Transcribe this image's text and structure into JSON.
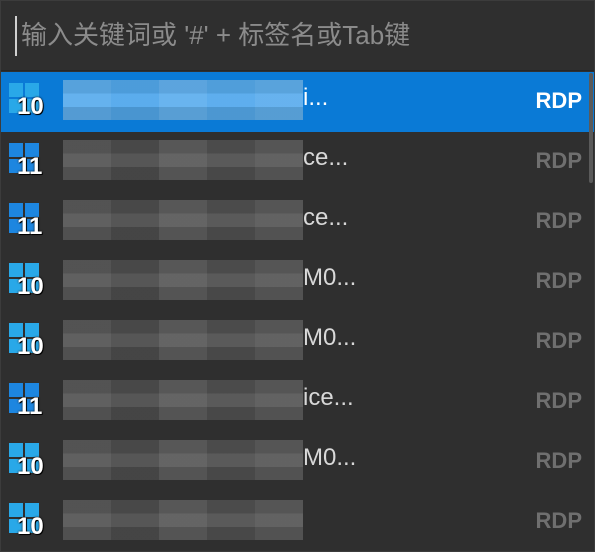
{
  "search": {
    "placeholder": "输入关键词或 '#' + 标签名或Tab键",
    "value": ""
  },
  "items": [
    {
      "os_version": "10",
      "name_suffix": "i...",
      "protocol": "RDP",
      "selected": true
    },
    {
      "os_version": "11",
      "name_suffix": "ce...",
      "protocol": "RDP",
      "selected": false
    },
    {
      "os_version": "11",
      "name_suffix": "ce...",
      "protocol": "RDP",
      "selected": false
    },
    {
      "os_version": "10",
      "name_suffix": "M0...",
      "protocol": "RDP",
      "selected": false
    },
    {
      "os_version": "10",
      "name_suffix": "M0...",
      "protocol": "RDP",
      "selected": false
    },
    {
      "os_version": "11",
      "name_suffix": "ice...",
      "protocol": "RDP",
      "selected": false
    },
    {
      "os_version": "10",
      "name_suffix": "M0...",
      "protocol": "RDP",
      "selected": false
    },
    {
      "os_version": "10",
      "name_suffix": "",
      "protocol": "RDP",
      "selected": false
    }
  ],
  "colors": {
    "selection": "#0a7ad6",
    "background": "#2f2f2f",
    "win10_icon": "#29a8e8",
    "win11_icon": "#1d86e0"
  },
  "icons": {
    "os": "windows-logo-icon"
  }
}
